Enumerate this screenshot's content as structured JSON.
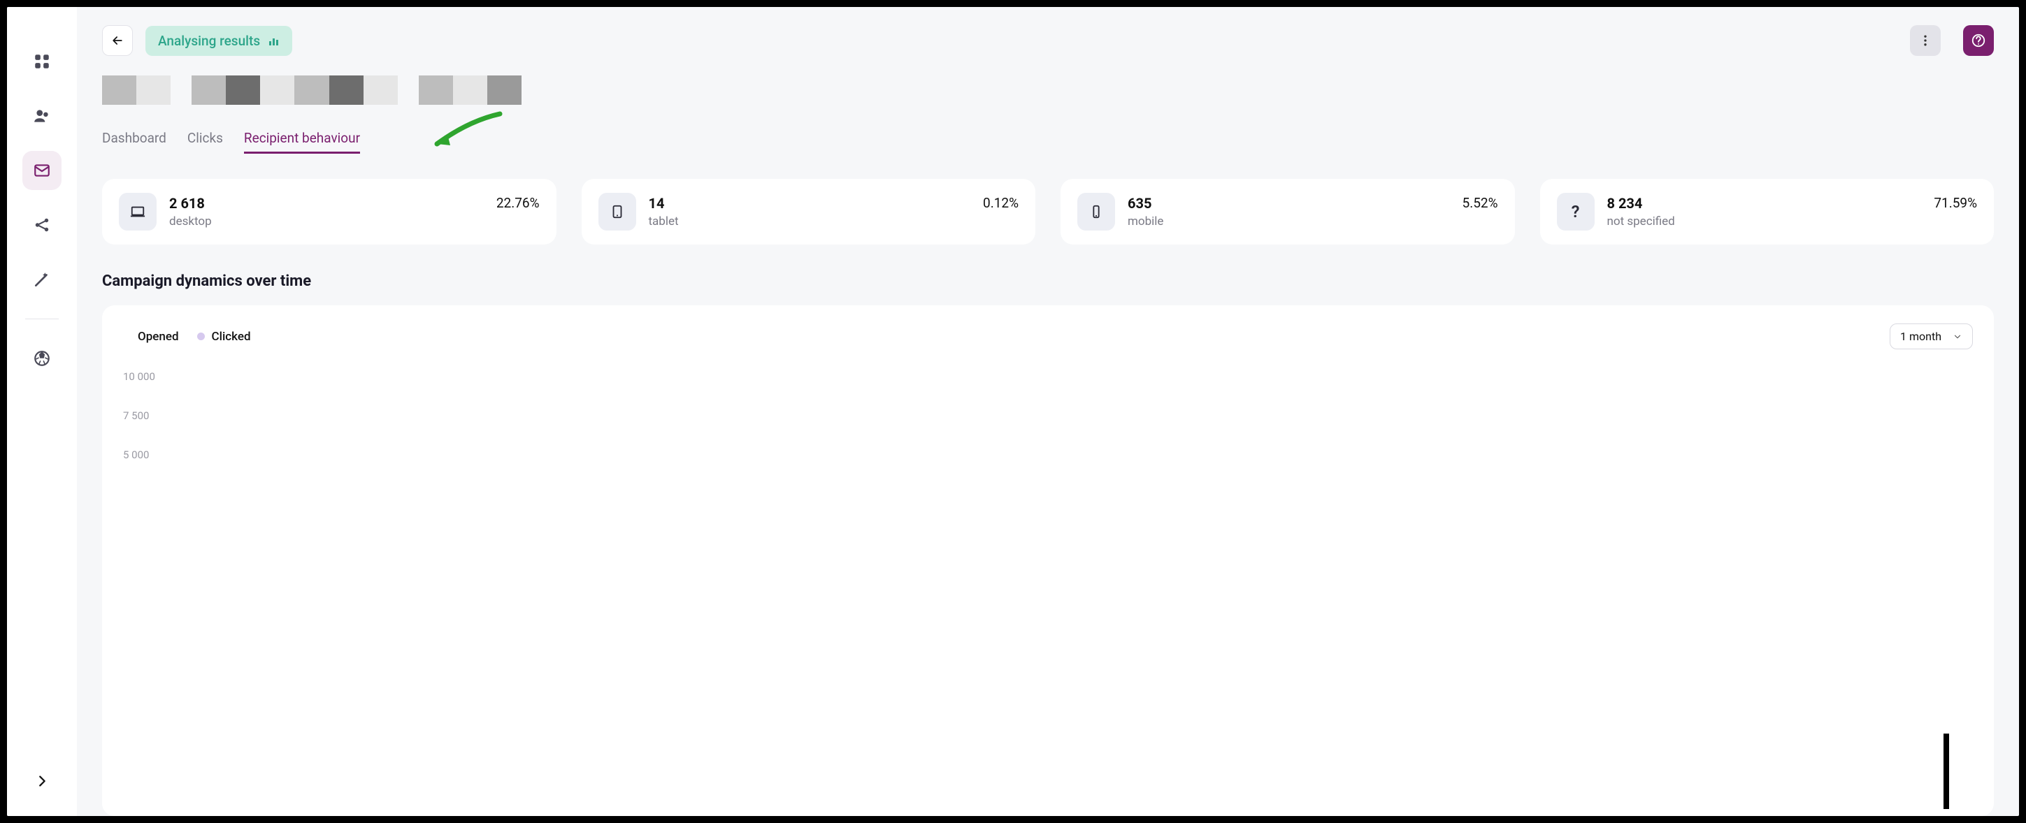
{
  "header": {
    "status_label": "Analysing results"
  },
  "tabs": [
    {
      "id": "dashboard",
      "label": "Dashboard"
    },
    {
      "id": "clicks",
      "label": "Clicks"
    },
    {
      "id": "recipient-behaviour",
      "label": "Recipient behaviour"
    }
  ],
  "active_tab": "recipient-behaviour",
  "stats": {
    "desktop": {
      "count": "2 618",
      "label": "desktop",
      "pct": "22.76%"
    },
    "tablet": {
      "count": "14",
      "label": "tablet",
      "pct": "0.12%"
    },
    "mobile": {
      "count": "635",
      "label": "mobile",
      "pct": "5.52%"
    },
    "not_specified": {
      "count": "8 234",
      "label": "not specified",
      "pct": "71.59%"
    }
  },
  "section": {
    "dynamics_title": "Campaign dynamics over time"
  },
  "chart": {
    "legend": {
      "opened": "Opened",
      "clicked": "Clicked"
    },
    "range_label": "1 month"
  },
  "chart_data": {
    "type": "line",
    "series": [
      {
        "name": "Opened",
        "values": []
      },
      {
        "name": "Clicked",
        "values": []
      }
    ],
    "ylabel": "",
    "xlabel": "",
    "y_ticks": [
      "10 000",
      "7 500",
      "5 000"
    ],
    "ylim": [
      0,
      10000
    ]
  }
}
